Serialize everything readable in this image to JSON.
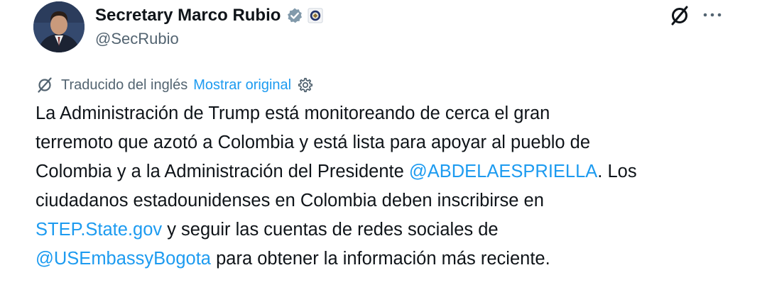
{
  "author": {
    "name": "Secretary Marco Rubio",
    "handle": "@SecRubio",
    "avatar_icon": "avatar-photo",
    "verified_icon": "verified-badge-icon",
    "affiliation_icon": "government-seal-icon"
  },
  "actions": {
    "grok_icon": "grok-icon",
    "more_label": "···"
  },
  "translation": {
    "icon": "translate-icon",
    "label": "Traducido del inglés",
    "show_original": "Mostrar original",
    "settings_icon": "gear-icon"
  },
  "tweet": {
    "line1": "La Administración de Trump está monitoreando de cerca el gran",
    "line2": "terremoto que azotó a Colombia y está lista para apoyar al pueblo de",
    "line3_pre": "Colombia y a la Administración del Presidente ",
    "line3_mention": "@ABDELAESPRIELLA",
    "line3_post": ". Los",
    "line4": "ciudadanos estadounidenses en Colombia deben inscribirse en",
    "line5_link": "STEP.State.gov",
    "line5_post": " y seguir las cuentas de redes sociales de",
    "line6_mention": "@USEmbassyBogota",
    "line6_post": " para obtener la información más reciente."
  },
  "colors": {
    "text": "#0f1419",
    "secondary": "#536471",
    "link": "#1d9bf0",
    "verified_badge": "#829aab"
  }
}
